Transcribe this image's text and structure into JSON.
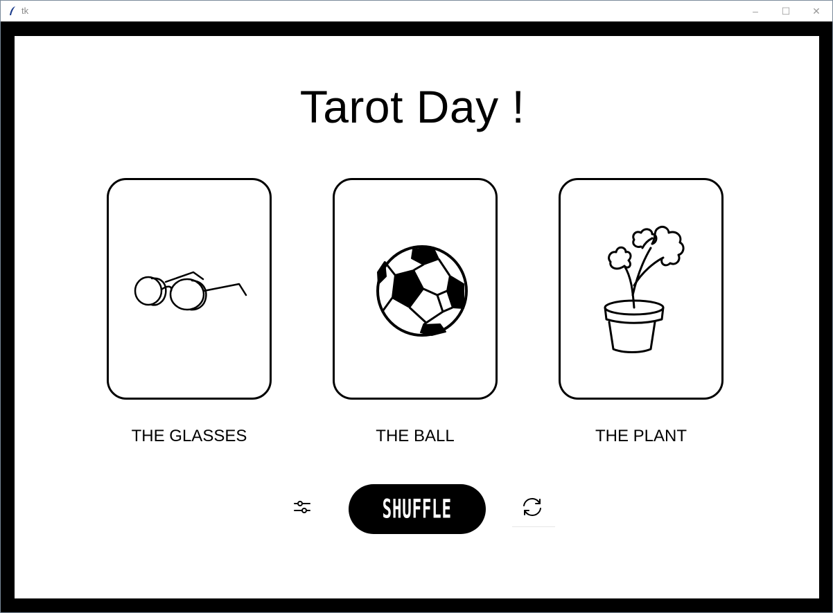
{
  "window": {
    "title": "tk",
    "controls": {
      "minimize": "–",
      "maximize": "☐",
      "close": "✕"
    }
  },
  "page": {
    "title": "Tarot Day !"
  },
  "cards": [
    {
      "label": "THE GLASSES",
      "icon": "glasses-icon"
    },
    {
      "label": "THE BALL",
      "icon": "soccer-ball-icon"
    },
    {
      "label": "THE PLANT",
      "icon": "potted-plant-icon"
    }
  ],
  "toolbar": {
    "settings_icon": "sliders-icon",
    "shuffle_label": "SHUFFLE",
    "refresh_icon": "refresh-icon"
  },
  "colors": {
    "background": "#ffffff",
    "ink": "#000000"
  }
}
